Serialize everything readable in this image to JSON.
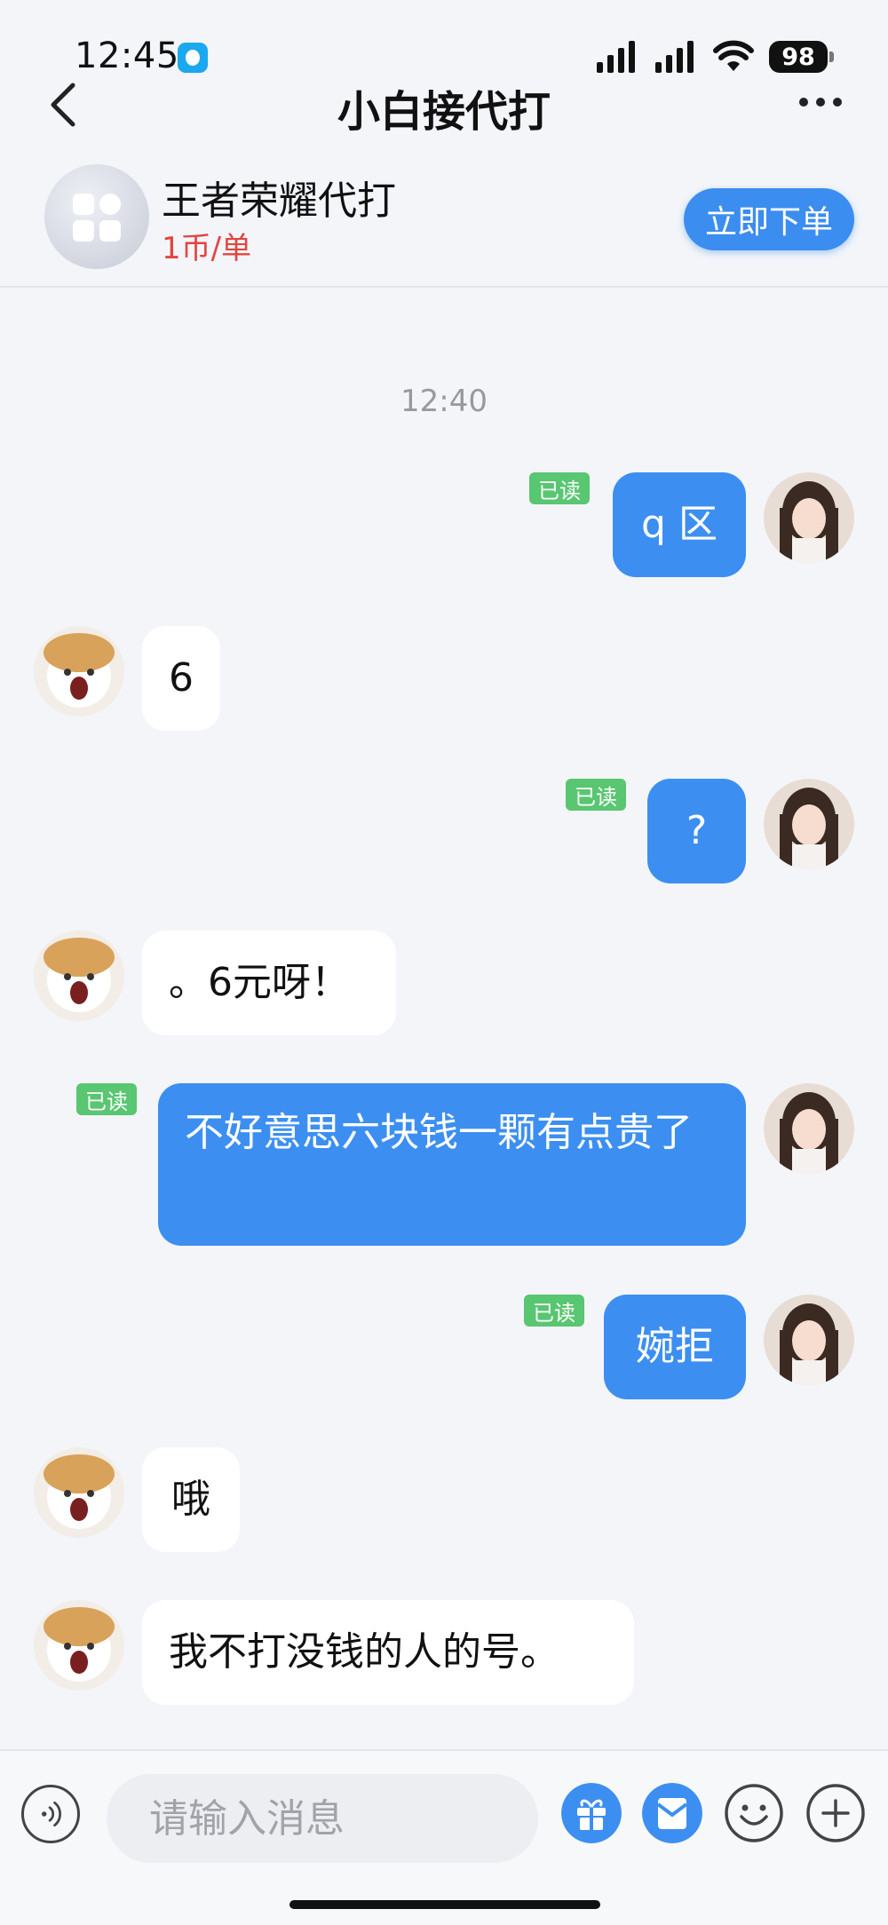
{
  "status_bar": {
    "time": "12:45",
    "battery": "98"
  },
  "header": {
    "title": "小白接代打"
  },
  "service": {
    "name": "王者荣耀代打",
    "price": "1币/单",
    "order_button": "立即下单"
  },
  "chat": {
    "time_marker": "12:40",
    "messages": [
      {
        "from": "me",
        "text": "q 区",
        "status": "已读"
      },
      {
        "from": "other",
        "text": "6"
      },
      {
        "from": "me",
        "text": "?",
        "status": "已读"
      },
      {
        "from": "other",
        "text": "。6元呀！"
      },
      {
        "from": "me",
        "text": "不好意思六块钱一颗有点贵了",
        "status": "已读"
      },
      {
        "from": "me",
        "text": "婉拒",
        "status": "已读"
      },
      {
        "from": "other",
        "text": "哦"
      },
      {
        "from": "other",
        "text": "我不打没钱的人的号。"
      }
    ]
  },
  "input_bar": {
    "placeholder": "请输入消息"
  },
  "icons": {
    "back": "chevron-left-icon",
    "more": "more-dots-icon",
    "voice": "voice-icon",
    "gift": "gift-icon",
    "coupon": "coupon-icon",
    "emoji": "emoji-icon",
    "add": "plus-icon"
  },
  "colors": {
    "accent": "#3c8ff1",
    "price": "#e2453f",
    "read_badge": "#59c671",
    "background": "#f3f5f9"
  }
}
